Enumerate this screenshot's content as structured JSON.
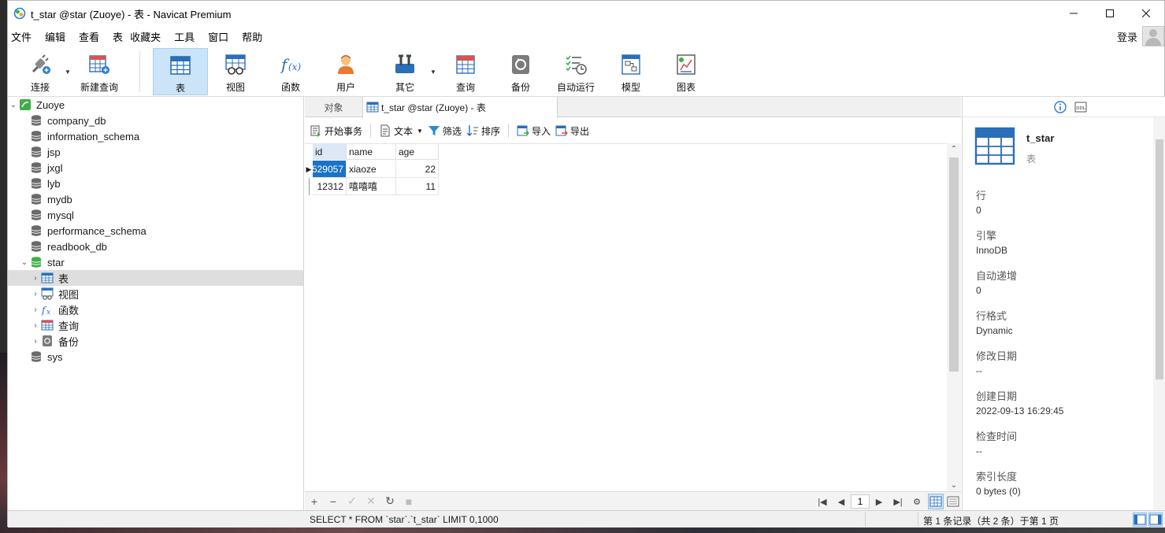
{
  "window": {
    "title": "t_star @star (Zuoye) - 表 - Navicat Premium"
  },
  "menu": [
    "文件",
    "编辑",
    "查看",
    "表",
    "收藏夹",
    "工具",
    "窗口",
    "帮助"
  ],
  "login_label": "登录",
  "toolbar": {
    "connect": "连接",
    "new_query": "新建查询",
    "table": "表",
    "view": "视图",
    "function": "函数",
    "user": "用户",
    "other": "其它",
    "query": "查询",
    "backup": "备份",
    "automation": "自动运行",
    "model": "模型",
    "chart": "图表"
  },
  "tree": {
    "connection": "Zuoye",
    "databases": [
      "company_db",
      "information_schema",
      "jsp",
      "jxgl",
      "lyb",
      "mydb",
      "mysql",
      "performance_schema",
      "readbook_db"
    ],
    "open_db": "star",
    "open_db_children": [
      "表",
      "视图",
      "函数",
      "查询",
      "备份"
    ],
    "last_db": "sys"
  },
  "tabs": {
    "objects": "对象",
    "current": "t_star @star (Zuoye) - 表"
  },
  "subtoolbar": {
    "begin_tx": "开始事务",
    "text": "文本",
    "filter": "筛选",
    "sort": "排序",
    "import": "导入",
    "export": "导出"
  },
  "grid": {
    "columns": [
      "id",
      "name",
      "age"
    ],
    "rows": [
      {
        "id": "529057",
        "name": "xiaoze",
        "age": "22"
      },
      {
        "id": "12312",
        "name": "嘻嘻嘻",
        "age": "11"
      }
    ]
  },
  "pager": {
    "page": "1"
  },
  "info": {
    "name": "t_star",
    "type": "表",
    "fields": [
      {
        "label": "行",
        "value": "0"
      },
      {
        "label": "引擎",
        "value": "InnoDB"
      },
      {
        "label": "自动递增",
        "value": "0"
      },
      {
        "label": "行格式",
        "value": "Dynamic"
      },
      {
        "label": "修改日期",
        "value": "--"
      },
      {
        "label": "创建日期",
        "value": "2022-09-13 16:29:45"
      },
      {
        "label": "检查时间",
        "value": "--"
      },
      {
        "label": "索引长度",
        "value": "0 bytes (0)"
      }
    ],
    "ddl_icon": "DDL"
  },
  "status": {
    "sql": "SELECT * FROM `star`.`t_star` LIMIT 0,1000",
    "records": "第 1 条记录（共 2 条）于第 1 页"
  },
  "colors": {
    "accent": "#1a73c9",
    "toolbar_active": "#cce4f7",
    "db_icon": "#6a6a6a",
    "open_db_icon": "#3fae49"
  }
}
